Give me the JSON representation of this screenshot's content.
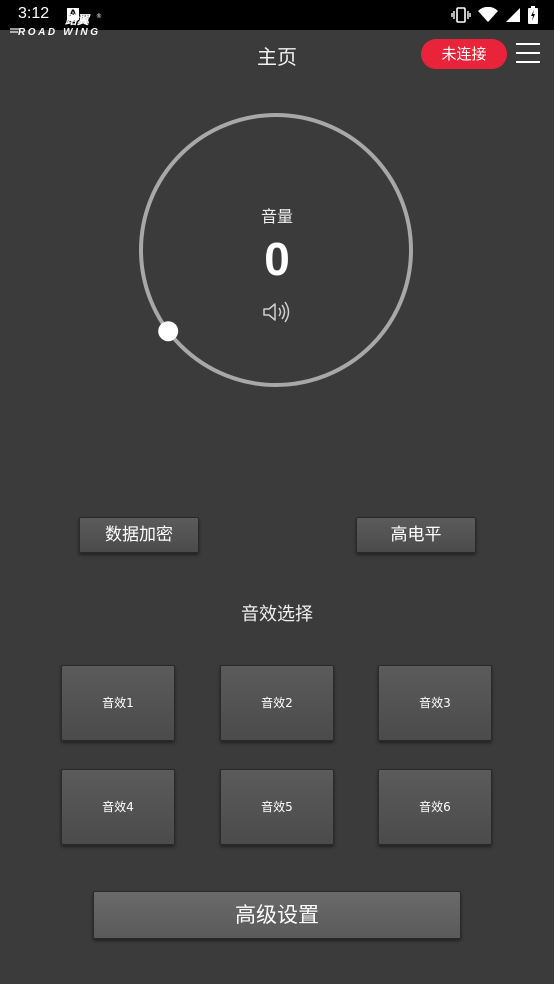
{
  "status": {
    "time": "3:12",
    "notif_icon": "A"
  },
  "header": {
    "logo_cn": "路翼",
    "logo_en": "ROAD WING",
    "title": "主页",
    "connection": "未连接",
    "connection_color": "#e8233a"
  },
  "volume": {
    "label": "音量",
    "value": "0",
    "level": 0
  },
  "toggles": {
    "encrypt": "数据加密",
    "level": "高电平"
  },
  "effects": {
    "title": "音效选择",
    "items": [
      "音效1",
      "音效2",
      "音效3",
      "音效4",
      "音效5",
      "音效6"
    ]
  },
  "advanced": "高级设置"
}
